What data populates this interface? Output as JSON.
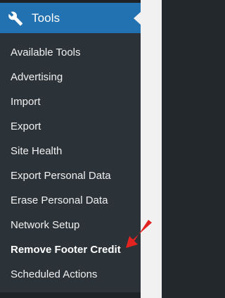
{
  "menu": {
    "title": "Tools",
    "icon": "wrench-icon",
    "accent_color": "#2271b1",
    "items": [
      {
        "label": "Available Tools"
      },
      {
        "label": "Advertising"
      },
      {
        "label": "Import"
      },
      {
        "label": "Export"
      },
      {
        "label": "Site Health"
      },
      {
        "label": "Export Personal Data"
      },
      {
        "label": "Erase Personal Data"
      },
      {
        "label": "Network Setup"
      },
      {
        "label": "Remove Footer Credit",
        "current": true
      },
      {
        "label": "Scheduled Actions"
      }
    ]
  },
  "annotation": {
    "icon": "red-arrow-icon",
    "color": "#e3231f"
  }
}
